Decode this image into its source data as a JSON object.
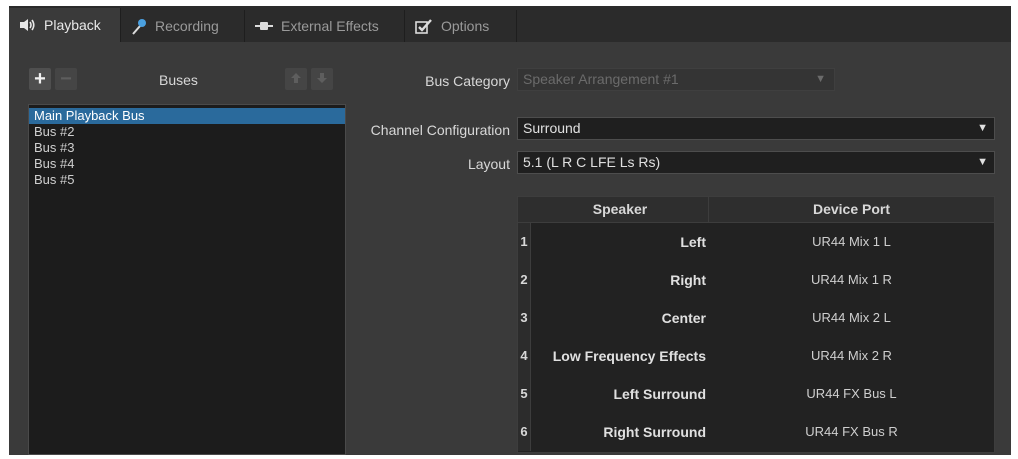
{
  "tabs": [
    {
      "label": "Playback",
      "icon": "speaker-icon",
      "active": true
    },
    {
      "label": "Recording",
      "icon": "microphone-icon",
      "active": false
    },
    {
      "label": "External Effects",
      "icon": "plug-icon",
      "active": false
    },
    {
      "label": "Options",
      "icon": "checkbox-icon",
      "active": false
    }
  ],
  "buses": {
    "label": "Buses",
    "add_symbol": "+",
    "remove_symbol": "−",
    "items": [
      "Main Playback Bus",
      "Bus #2",
      "Bus #3",
      "Bus #4",
      "Bus #5"
    ],
    "selected": "Main Playback Bus"
  },
  "form": {
    "bus_category_label": "Bus Category",
    "bus_category_value": "Speaker Arrangement #1",
    "channel_config_label": "Channel Configuration",
    "channel_config_value": "Surround",
    "layout_label": "Layout",
    "layout_value": "5.1 (L R C LFE Ls Rs)"
  },
  "table": {
    "headers": {
      "speaker": "Speaker",
      "port": "Device Port"
    },
    "rows": [
      {
        "num": "1",
        "speaker": "Left",
        "port": "UR44 Mix 1 L"
      },
      {
        "num": "2",
        "speaker": "Right",
        "port": "UR44 Mix 1 R"
      },
      {
        "num": "3",
        "speaker": "Center",
        "port": "UR44 Mix 2 L"
      },
      {
        "num": "4",
        "speaker": "Low Frequency Effects",
        "port": "UR44 Mix 2 R"
      },
      {
        "num": "5",
        "speaker": "Left Surround",
        "port": "UR44 FX Bus L"
      },
      {
        "num": "6",
        "speaker": "Right Surround",
        "port": "UR44 FX Bus R"
      }
    ]
  },
  "colors": {
    "panel": "#3a3a3a",
    "list_bg": "#1c1c1c",
    "selection": "#2a6a9c"
  }
}
